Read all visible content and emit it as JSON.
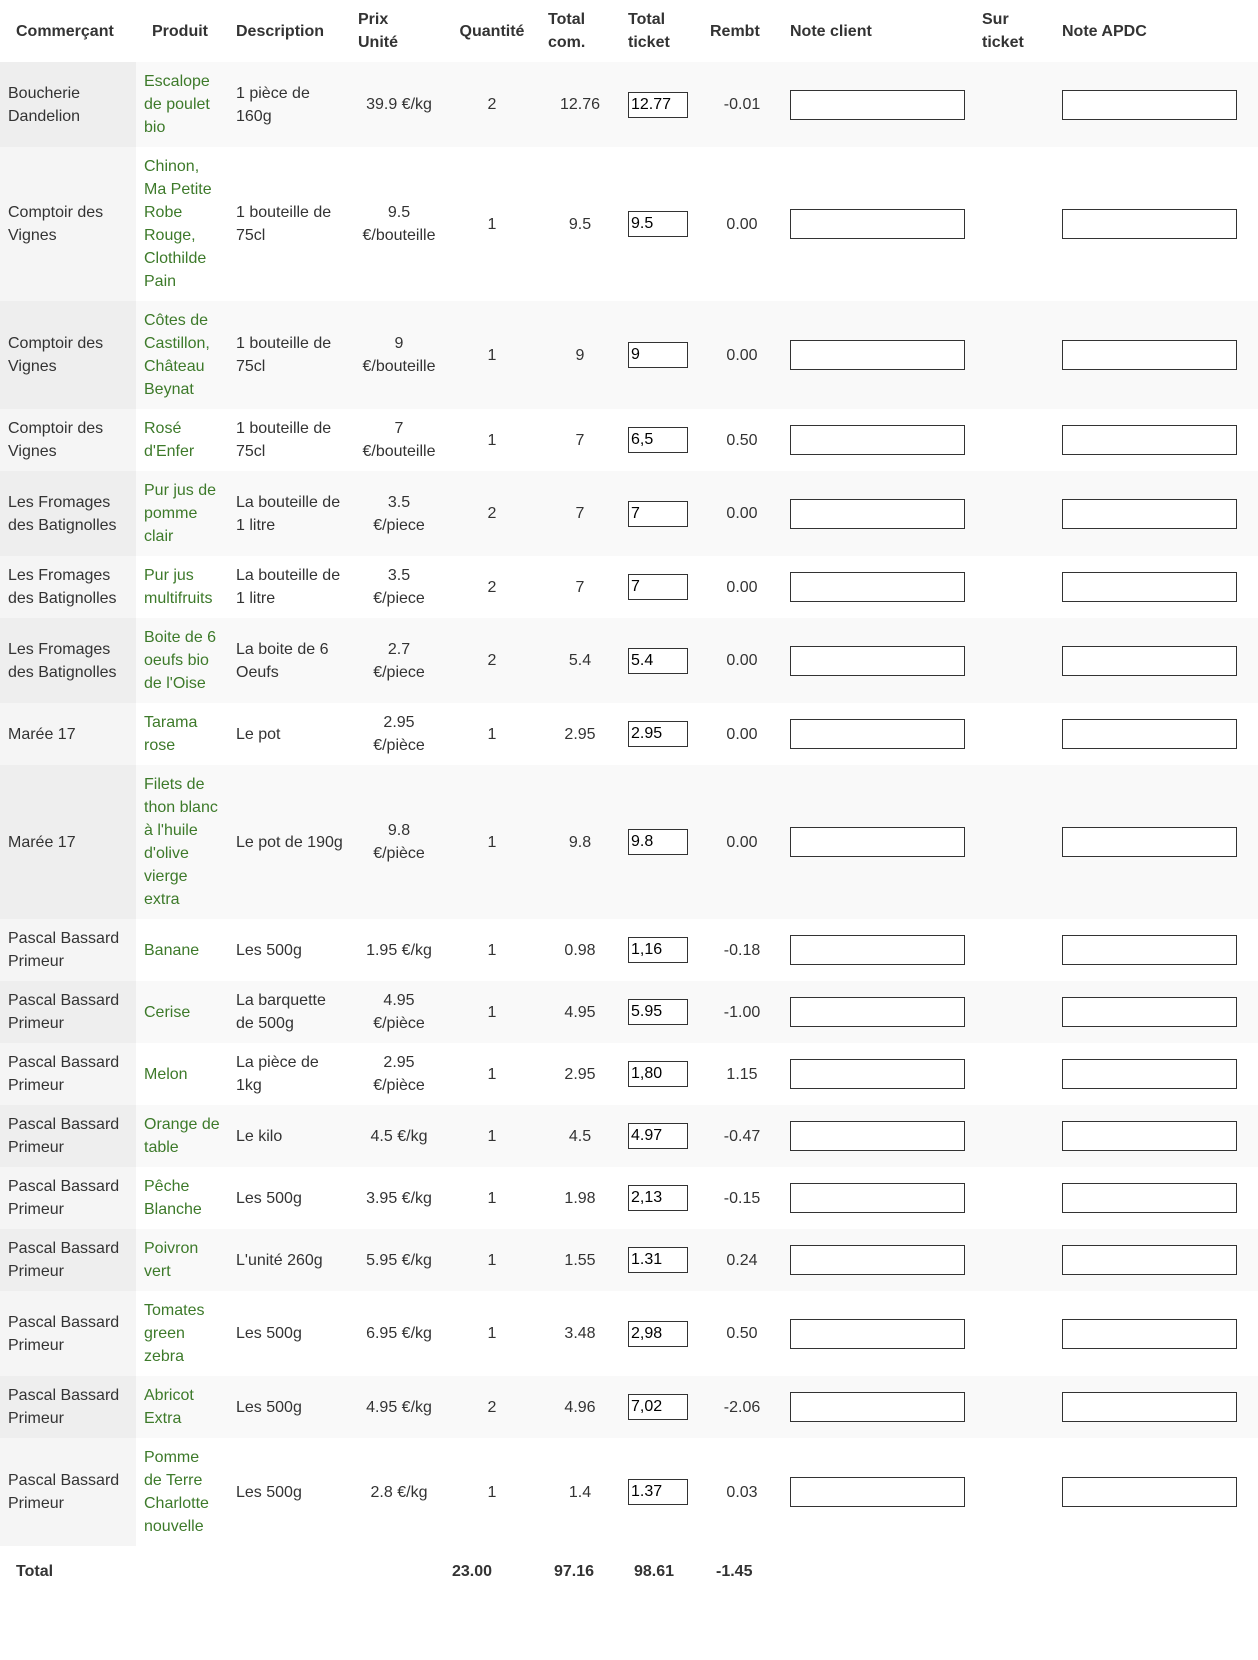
{
  "headers": {
    "merchant": "Commerçant",
    "product": "Produit",
    "description": "Description",
    "unit_price": "Prix Unité",
    "quantity": "Quantité",
    "total_order": "Total com.",
    "total_ticket": "Total ticket",
    "refund": "Rembt",
    "client_note": "Note client",
    "on_ticket": "Sur ticket",
    "apdc_note": "Note APDC"
  },
  "rows": [
    {
      "merchant": "Boucherie Dandelion",
      "product": "Escalope de poulet bio",
      "description": "1 pièce de 160g",
      "unit_price": "39.9 €/kg",
      "quantity": "2",
      "total_order": "12.76",
      "total_ticket": "12.77",
      "refund": "-0.01"
    },
    {
      "merchant": "Comptoir des Vignes",
      "product": "Chinon, Ma Petite Robe Rouge, Clothilde Pain",
      "description": "1 bouteille de 75cl",
      "unit_price": "9.5 €/bouteille",
      "quantity": "1",
      "total_order": "9.5",
      "total_ticket": "9.5",
      "refund": "0.00"
    },
    {
      "merchant": "Comptoir des Vignes",
      "product": "Côtes de Castillon, Château Beynat",
      "description": "1 bouteille de 75cl",
      "unit_price": "9 €/bouteille",
      "quantity": "1",
      "total_order": "9",
      "total_ticket": "9",
      "refund": "0.00"
    },
    {
      "merchant": "Comptoir des Vignes",
      "product": "Rosé d'Enfer",
      "description": "1 bouteille de 75cl",
      "unit_price": "7 €/bouteille",
      "quantity": "1",
      "total_order": "7",
      "total_ticket": "6,5",
      "refund": "0.50"
    },
    {
      "merchant": "Les Fromages des Batignolles",
      "product": "Pur jus de pomme clair",
      "description": "La bouteille de 1 litre",
      "unit_price": "3.5 €/piece",
      "quantity": "2",
      "total_order": "7",
      "total_ticket": "7",
      "refund": "0.00"
    },
    {
      "merchant": "Les Fromages des Batignolles",
      "product": "Pur jus multifruits",
      "description": "La bouteille de 1 litre",
      "unit_price": "3.5 €/piece",
      "quantity": "2",
      "total_order": "7",
      "total_ticket": "7",
      "refund": "0.00"
    },
    {
      "merchant": "Les Fromages des Batignolles",
      "product": "Boite de 6 oeufs bio de l'Oise",
      "description": "La boite de 6 Oeufs",
      "unit_price": "2.7 €/piece",
      "quantity": "2",
      "total_order": "5.4",
      "total_ticket": "5.4",
      "refund": "0.00"
    },
    {
      "merchant": "Marée 17",
      "product": "Tarama rose",
      "description": "Le pot",
      "unit_price": "2.95 €/pièce",
      "quantity": "1",
      "total_order": "2.95",
      "total_ticket": "2.95",
      "refund": "0.00"
    },
    {
      "merchant": "Marée 17",
      "product": "Filets de thon blanc à l'huile d'olive vierge extra",
      "description": "Le pot de 190g",
      "unit_price": "9.8 €/pièce",
      "quantity": "1",
      "total_order": "9.8",
      "total_ticket": "9.8",
      "refund": "0.00"
    },
    {
      "merchant": "Pascal Bassard Primeur",
      "product": "Banane",
      "description": "Les 500g",
      "unit_price": "1.95 €/kg",
      "quantity": "1",
      "total_order": "0.98",
      "total_ticket": "1,16",
      "refund": "-0.18"
    },
    {
      "merchant": "Pascal Bassard Primeur",
      "product": "Cerise",
      "description": "La barquette de 500g",
      "unit_price": "4.95 €/pièce",
      "quantity": "1",
      "total_order": "4.95",
      "total_ticket": "5.95",
      "refund": "-1.00"
    },
    {
      "merchant": "Pascal Bassard Primeur",
      "product": "Melon",
      "description": "La pièce de 1kg",
      "unit_price": "2.95 €/pièce",
      "quantity": "1",
      "total_order": "2.95",
      "total_ticket": "1,80",
      "refund": "1.15"
    },
    {
      "merchant": "Pascal Bassard Primeur",
      "product": "Orange de table",
      "description": "Le kilo",
      "unit_price": "4.5 €/kg",
      "quantity": "1",
      "total_order": "4.5",
      "total_ticket": "4.97",
      "refund": "-0.47"
    },
    {
      "merchant": "Pascal Bassard Primeur",
      "product": "Pêche Blanche",
      "description": "Les 500g",
      "unit_price": "3.95 €/kg",
      "quantity": "1",
      "total_order": "1.98",
      "total_ticket": "2,13",
      "refund": "-0.15"
    },
    {
      "merchant": "Pascal Bassard Primeur",
      "product": "Poivron vert",
      "description": "L'unité 260g",
      "unit_price": "5.95 €/kg",
      "quantity": "1",
      "total_order": "1.55",
      "total_ticket": "1.31",
      "refund": "0.24"
    },
    {
      "merchant": "Pascal Bassard Primeur",
      "product": "Tomates green zebra",
      "description": "Les 500g",
      "unit_price": "6.95 €/kg",
      "quantity": "1",
      "total_order": "3.48",
      "total_ticket": "2,98",
      "refund": "0.50"
    },
    {
      "merchant": "Pascal Bassard Primeur",
      "product": "Abricot Extra",
      "description": "Les 500g",
      "unit_price": "4.95 €/kg",
      "quantity": "2",
      "total_order": "4.96",
      "total_ticket": "7,02",
      "refund": "-2.06"
    },
    {
      "merchant": "Pascal Bassard Primeur",
      "product": "Pomme de Terre Charlotte nouvelle",
      "description": "Les 500g",
      "unit_price": "2.8 €/kg",
      "quantity": "1",
      "total_order": "1.4",
      "total_ticket": "1.37",
      "refund": "0.03"
    }
  ],
  "totals": {
    "label": "Total",
    "quantity": "23.00",
    "total_order": "97.16",
    "total_ticket": "98.61",
    "refund": "-1.45"
  }
}
